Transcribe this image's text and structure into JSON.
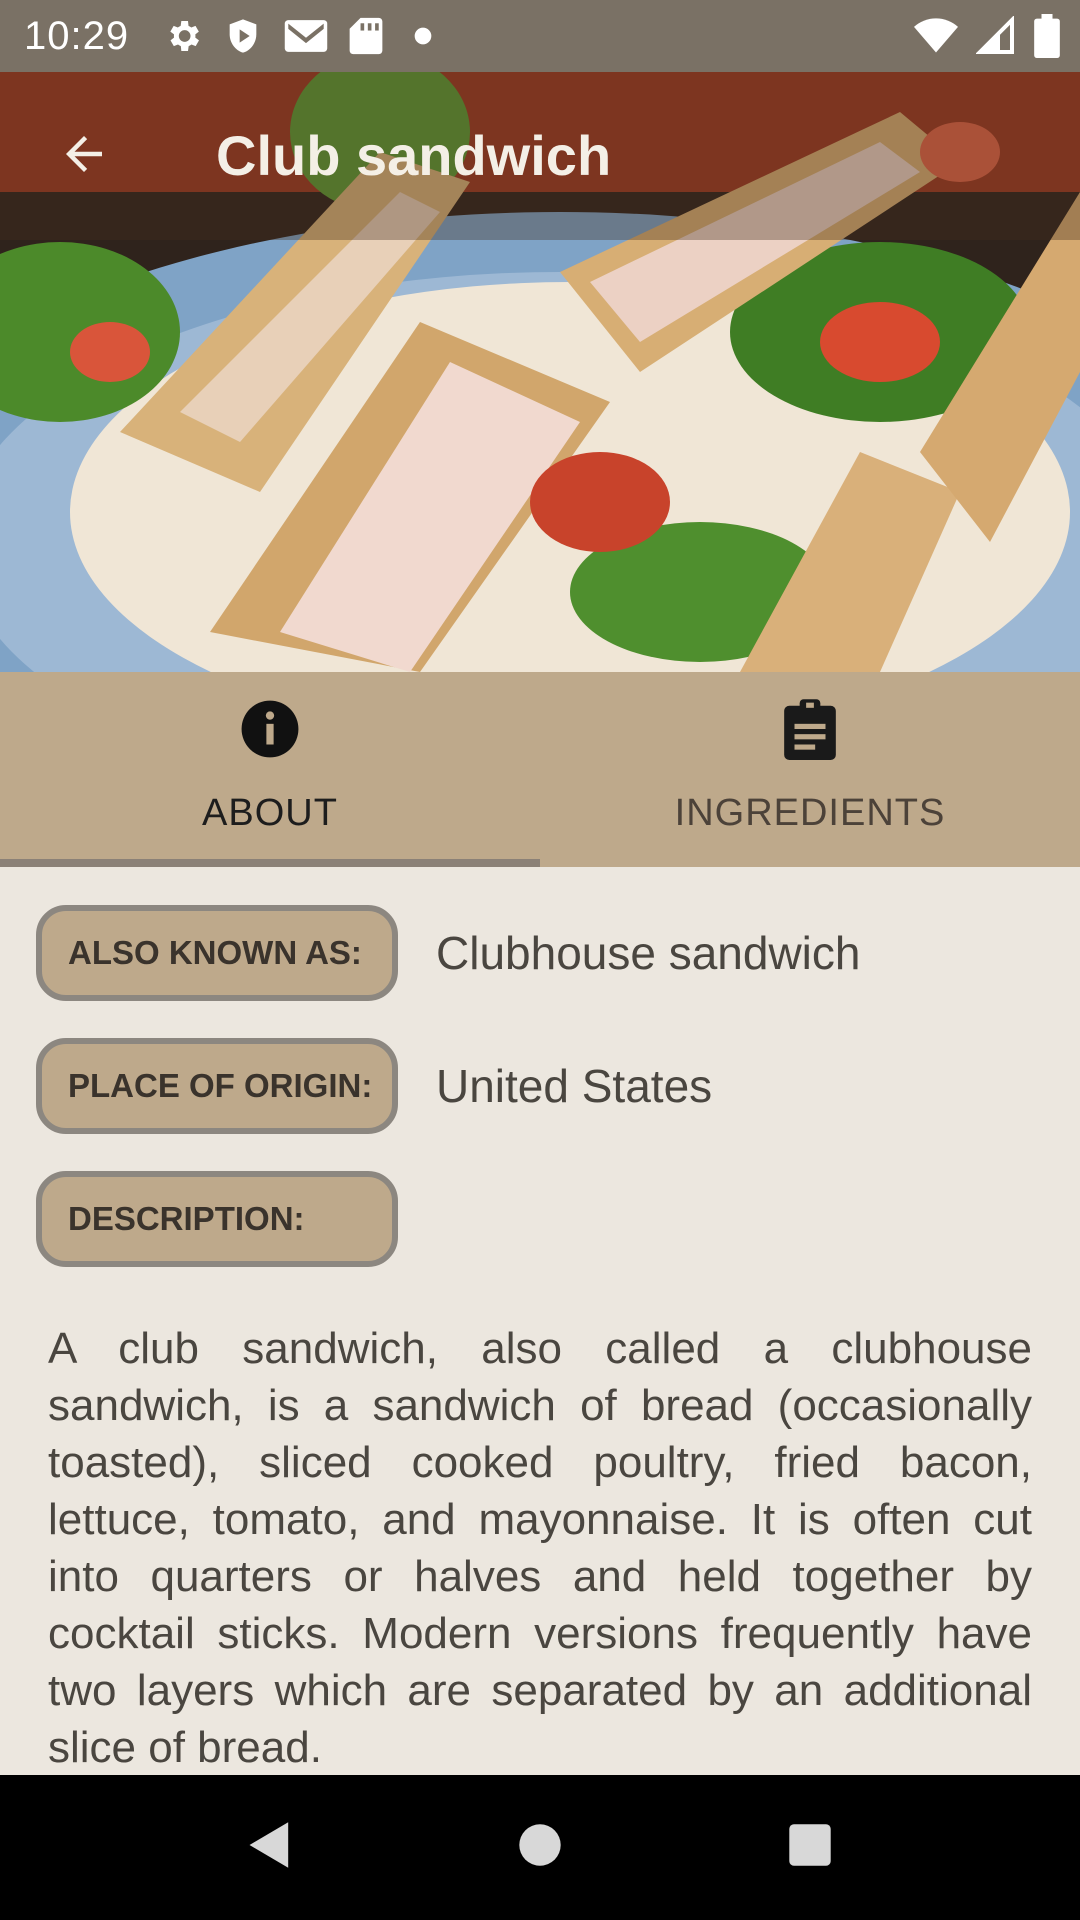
{
  "status_bar": {
    "time": "10:29",
    "left_icons": [
      "gear-icon",
      "shield-play-icon",
      "gmail-icon",
      "sd-card-icon",
      "dot-icon"
    ],
    "right_icons": [
      "wifi-icon",
      "signal-icon",
      "battery-icon"
    ]
  },
  "app_bar": {
    "title": "Club sandwich",
    "back_icon": "arrow-back-icon"
  },
  "tabs": [
    {
      "label": "ABOUT",
      "icon": "info-icon",
      "active": true
    },
    {
      "label": "INGREDIENTS",
      "icon": "clipboard-list-icon",
      "active": false
    }
  ],
  "about": {
    "also_known_as_label": "ALSO KNOWN AS:",
    "also_known_as_value": "Clubhouse sandwich",
    "place_of_origin_label": "PLACE OF ORIGIN:",
    "place_of_origin_value": "United States",
    "description_label": "DESCRIPTION:",
    "description_text": "A club sandwich, also called a clubhouse sandwich, is a sandwich of bread (occasionally toasted), sliced cooked poultry, fried bacon, lettuce, tomato, and mayonnaise. It is often cut into quarters or halves and held together by cocktail sticks. Modern versions frequently have two layers which are separated by an additional slice of bread."
  },
  "nav_bar": {
    "back_icon": "nav-back-icon",
    "home_icon": "nav-home-icon",
    "recents_icon": "nav-recents-icon"
  },
  "colors": {
    "status_bar": "#7A7165",
    "tab_bar": "#BEA98B",
    "content_bg": "#ECE7DF",
    "chip_border": "#8C8780"
  }
}
